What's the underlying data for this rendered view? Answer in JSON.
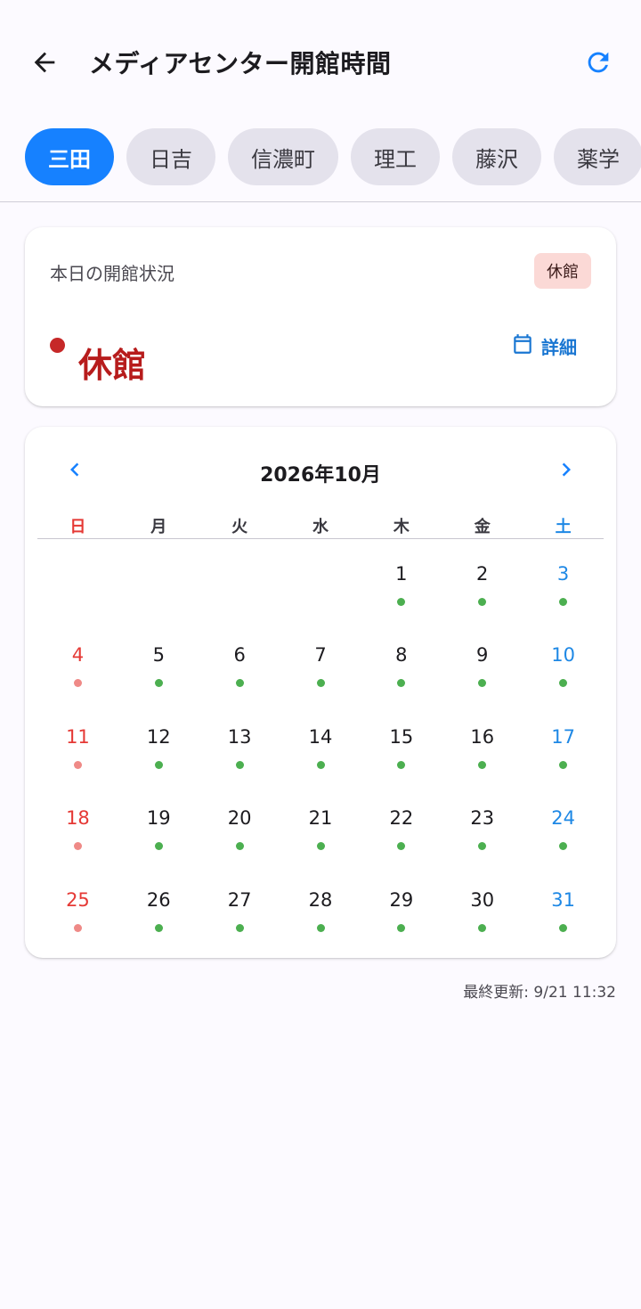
{
  "appbar": {
    "title": "メディアセンター開館時間",
    "back_icon": "arrow-left-icon",
    "refresh_icon": "refresh-icon"
  },
  "tabs": [
    {
      "label": "三田",
      "active": true
    },
    {
      "label": "日吉",
      "active": false
    },
    {
      "label": "信濃町",
      "active": false
    },
    {
      "label": "理工",
      "active": false
    },
    {
      "label": "藤沢",
      "active": false
    },
    {
      "label": "薬学",
      "active": false
    }
  ],
  "status": {
    "heading": "本日の開館状況",
    "badge": "休館",
    "main": "休館",
    "detail_label": "詳細",
    "detail_icon": "calendar-icon"
  },
  "calendar": {
    "title": "2026年10月",
    "weekdays": [
      "日",
      "月",
      "火",
      "水",
      "木",
      "金",
      "土"
    ],
    "weeks": [
      [
        "",
        "",
        "",
        "",
        "1",
        "2",
        "3"
      ],
      [
        "4",
        "5",
        "6",
        "7",
        "8",
        "9",
        "10"
      ],
      [
        "11",
        "12",
        "13",
        "14",
        "15",
        "16",
        "17"
      ],
      [
        "18",
        "19",
        "20",
        "21",
        "22",
        "23",
        "24"
      ],
      [
        "25",
        "26",
        "27",
        "28",
        "29",
        "30",
        "31"
      ]
    ]
  },
  "updated": "最終更新: 9/21 11:32",
  "colors": {
    "accent": "#1681ff",
    "closed_red": "#b71c1c",
    "open_dot": "#4caf50",
    "closed_dot": "#ef8a87",
    "sunday": "#e53935",
    "saturday": "#1e88e5"
  }
}
